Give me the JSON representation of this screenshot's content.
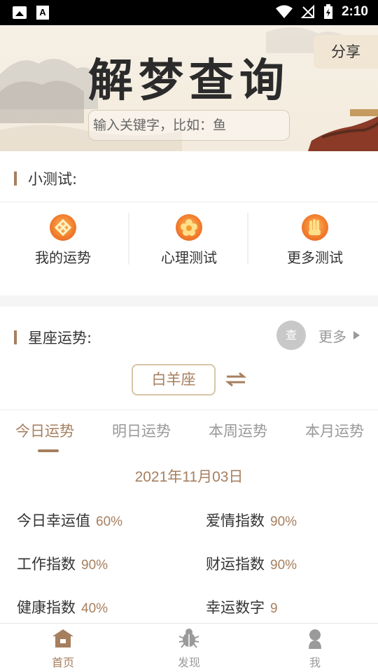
{
  "status_bar": {
    "time": "2:10"
  },
  "header": {
    "title": "解梦查询",
    "share_label": "分享",
    "search_placeholder": "输入关键字，比如：鱼"
  },
  "tests_section": {
    "title": "小测试:",
    "items": [
      {
        "label": "我的运势",
        "icon": "knot-icon"
      },
      {
        "label": "心理测试",
        "icon": "flower-icon"
      },
      {
        "label": "更多测试",
        "icon": "hand-icon"
      }
    ]
  },
  "horoscope_section": {
    "title": "星座运势:",
    "lookup_label": "查",
    "more_label": "更多",
    "sign": "白羊座",
    "tabs": [
      "今日运势",
      "明日运势",
      "本周运势",
      "本月运势"
    ],
    "active_tab": 0,
    "date": "2021年11月03日",
    "indices": [
      {
        "name": "今日幸运值",
        "value": "60%"
      },
      {
        "name": "爱情指数",
        "value": "90%"
      },
      {
        "name": "工作指数",
        "value": "90%"
      },
      {
        "name": "财运指数",
        "value": "90%"
      },
      {
        "name": "健康指数",
        "value": "40%"
      },
      {
        "name": "幸运数字",
        "value": "9"
      }
    ]
  },
  "bottom_nav": {
    "items": [
      {
        "label": "首页",
        "icon": "home-icon",
        "active": true
      },
      {
        "label": "发现",
        "icon": "bug-icon",
        "active": false
      },
      {
        "label": "我",
        "icon": "user-icon",
        "active": false
      }
    ]
  },
  "colors": {
    "accent": "#a67f5f",
    "header_bg": "#f3ebdd",
    "muted": "#999999"
  }
}
